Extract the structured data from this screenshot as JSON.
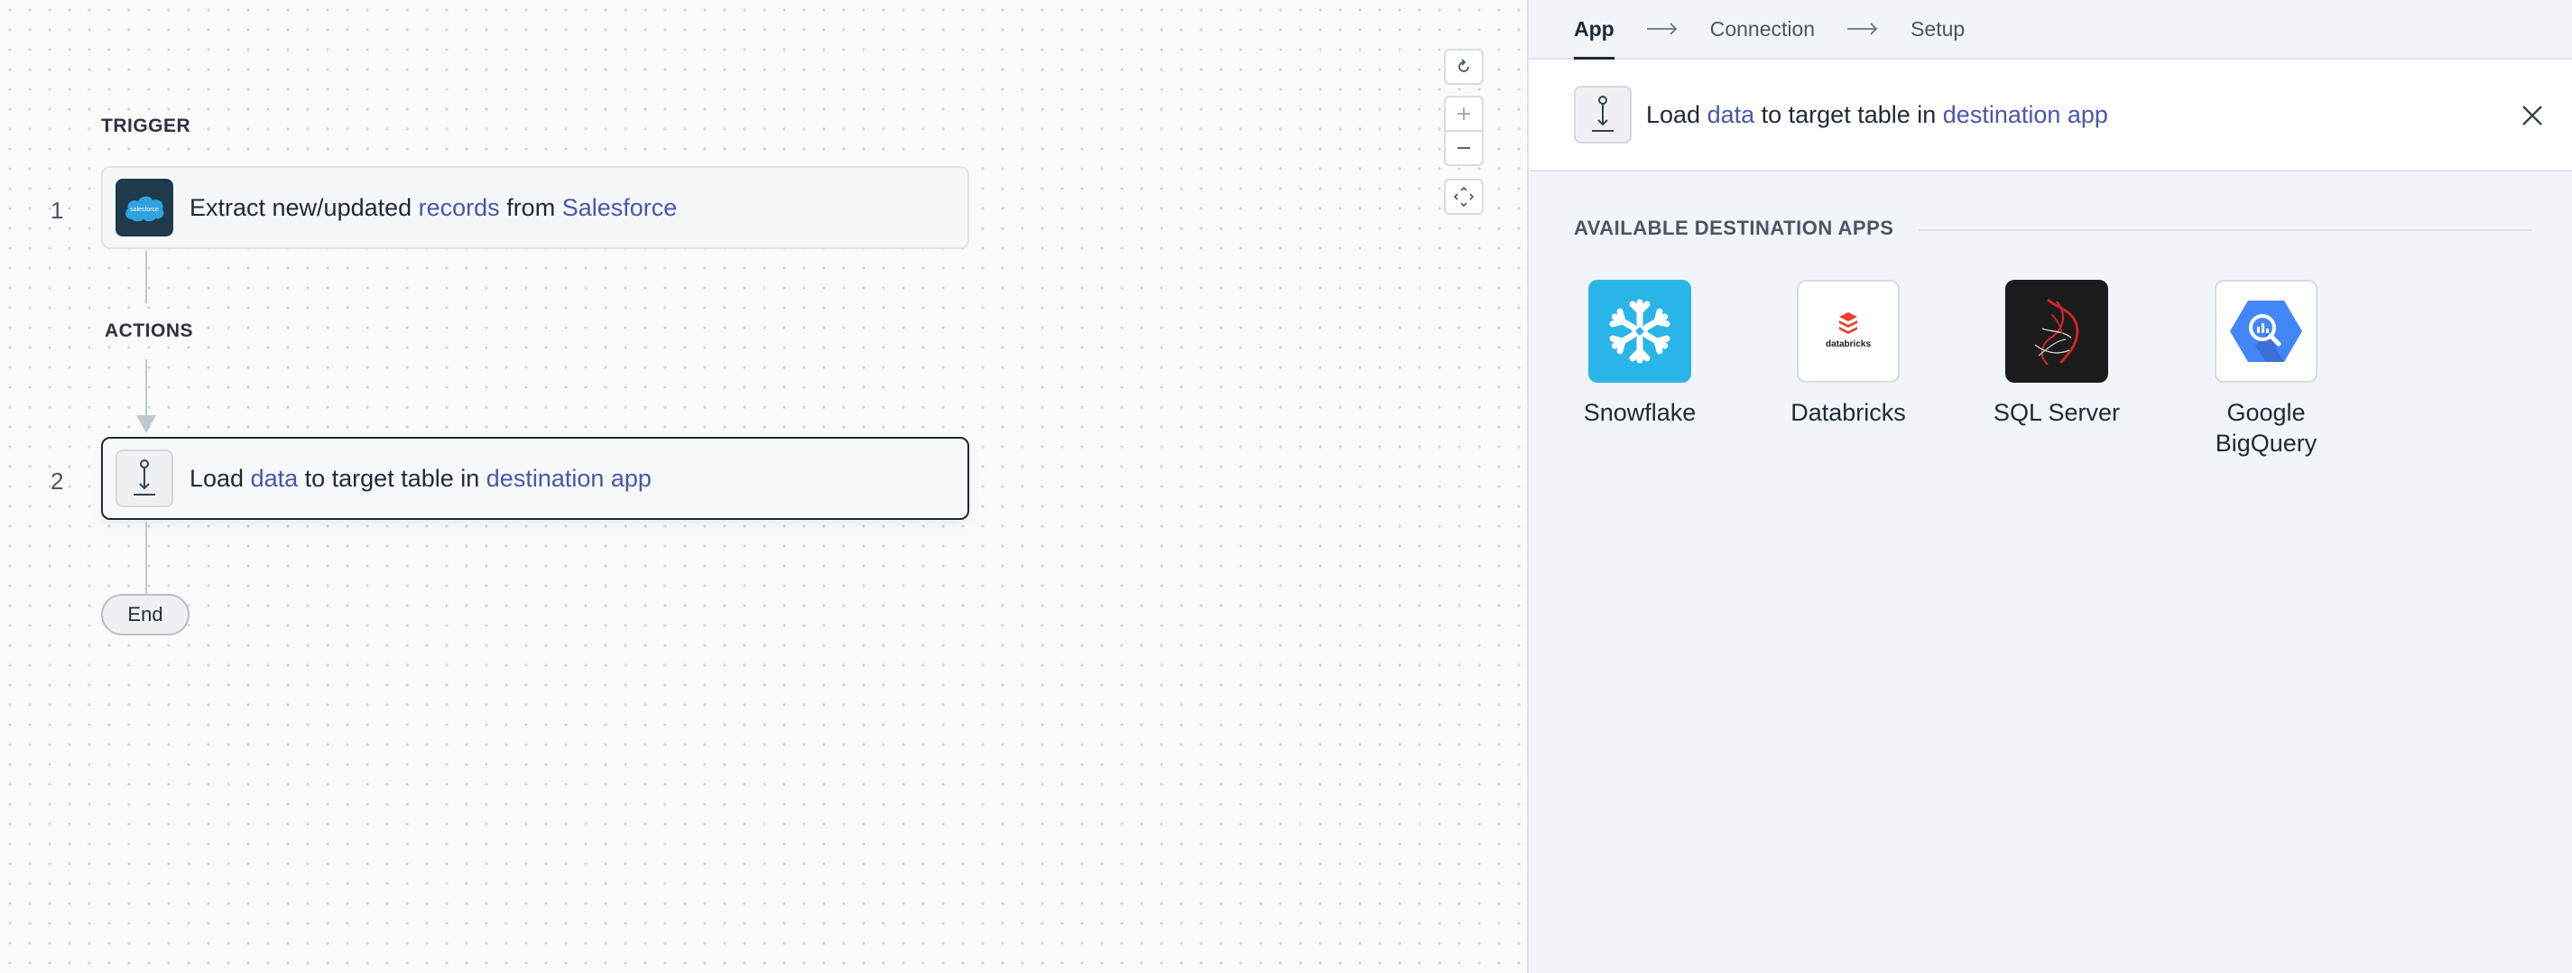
{
  "canvas": {
    "trigger_label": "TRIGGER",
    "actions_label": "ACTIONS",
    "steps": [
      {
        "number": "1",
        "parts": [
          "Extract new/updated ",
          "records",
          " from ",
          "Salesforce"
        ],
        "logo_text": "salesforce"
      },
      {
        "number": "2",
        "parts": [
          "Load ",
          "data",
          " to target table in ",
          "destination app"
        ]
      }
    ],
    "end_label": "End",
    "controls": [
      "reset-icon",
      "zoom-in-icon",
      "zoom-out-icon",
      "fit-view-icon"
    ]
  },
  "panel": {
    "wizard": [
      "App",
      "Connection",
      "Setup"
    ],
    "header_parts": [
      "Load ",
      "data",
      " to target table in ",
      "destination app"
    ],
    "available_label": "AVAILABLE DESTINATION APPS",
    "apps": [
      {
        "name": "Snowflake",
        "icon": "snowflake-icon"
      },
      {
        "name": "Databricks",
        "icon": "databricks-icon",
        "logo_text": "databricks"
      },
      {
        "name": "SQL Server",
        "icon": "sql-server-icon"
      },
      {
        "name": "Google BigQuery",
        "name_line1": "Google",
        "name_line2": "BigQuery",
        "icon": "bigquery-icon"
      }
    ]
  },
  "colors": {
    "highlight": "#4a56a8",
    "snowflake": "#29b5e8",
    "sql_server_bg": "#1b1b1b",
    "bigquery": "#4386fa",
    "salesforce_bg": "#1f3a4d"
  }
}
